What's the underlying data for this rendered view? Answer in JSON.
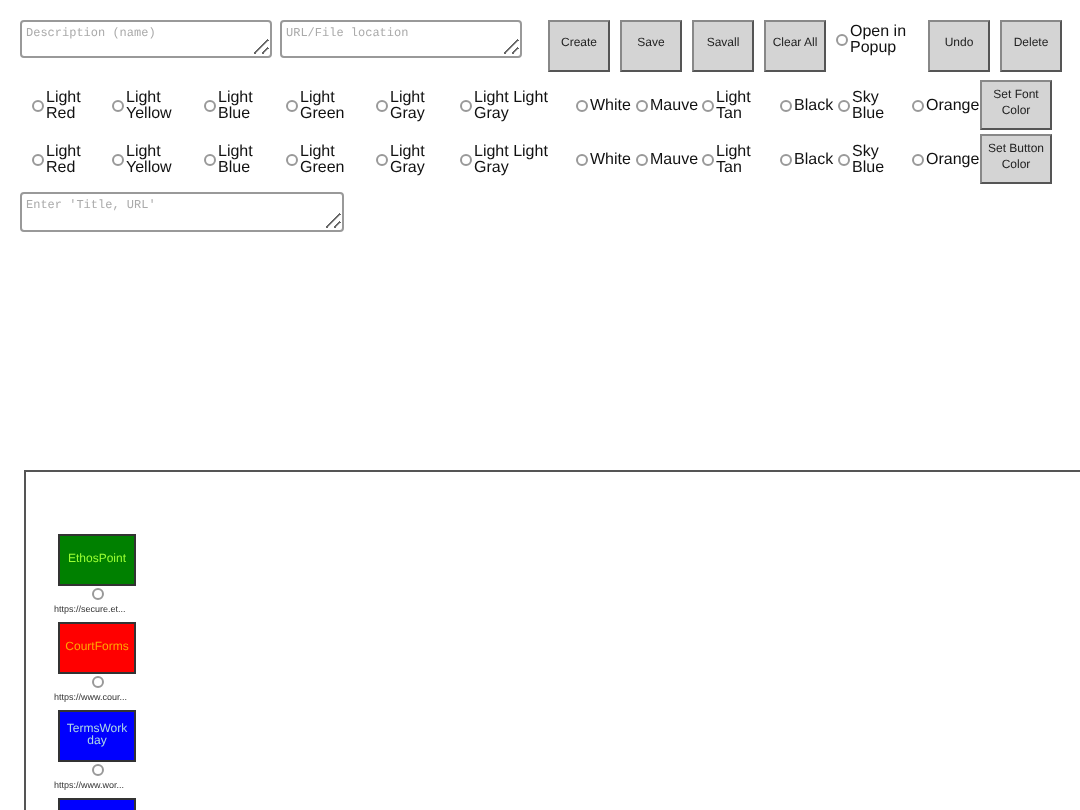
{
  "inputs": [
    {
      "placeholder": "Description (name)"
    },
    {
      "placeholder": "URL/File location"
    }
  ],
  "actions": [
    {
      "kind": "button",
      "label": "Create"
    },
    {
      "kind": "button",
      "label": "Save"
    },
    {
      "kind": "button",
      "label": "Savall"
    },
    {
      "kind": "button",
      "label": "Clear All"
    },
    {
      "kind": "radio",
      "label": "Open in Popup",
      "selected": false
    },
    {
      "kind": "button",
      "label": "Undo"
    },
    {
      "kind": "button",
      "label": "Delete"
    }
  ],
  "color_rows": [
    {
      "button": "Set Font Color",
      "options": [
        {
          "label": "Light Red",
          "selected": false
        },
        {
          "label": "Light Yellow",
          "selected": false
        },
        {
          "label": "Light Blue",
          "selected": false
        },
        {
          "label": "Light Green",
          "selected": false
        },
        {
          "label": "Light Gray",
          "selected": false
        },
        {
          "label": "Light Light Gray",
          "selected": false
        },
        {
          "label": "White",
          "selected": false
        },
        {
          "label": "Mauve",
          "selected": false
        },
        {
          "label": "Light Tan",
          "selected": false
        },
        {
          "label": "Black",
          "selected": false
        },
        {
          "label": "Sky Blue",
          "selected": false
        },
        {
          "label": "Orange",
          "selected": false
        }
      ]
    },
    {
      "button": "Set Button Color",
      "options": [
        {
          "label": "Light Red",
          "selected": false
        },
        {
          "label": "Light Yellow",
          "selected": false
        },
        {
          "label": "Light Blue",
          "selected": false
        },
        {
          "label": "Light Green",
          "selected": false
        },
        {
          "label": "Light Gray",
          "selected": false
        },
        {
          "label": "Light Light Gray",
          "selected": false
        },
        {
          "label": "White",
          "selected": false
        },
        {
          "label": "Mauve",
          "selected": false
        },
        {
          "label": "Light Tan",
          "selected": false
        },
        {
          "label": "Black",
          "selected": false
        },
        {
          "label": "Sky Blue",
          "selected": false
        },
        {
          "label": "Orange",
          "selected": false
        }
      ]
    }
  ],
  "bulk_input": {
    "placeholder": "Enter 'Title, URL'"
  },
  "links": [
    {
      "label": {
        "text": "EthosPoint",
        "color": "#99ff33"
      },
      "color": "#008000",
      "selected": false,
      "url": "https://secure.et..."
    },
    {
      "label": {
        "text": "CourtForms",
        "color": "#ffa500"
      },
      "color": "#ff0000",
      "selected": false,
      "url": "https://www.cour..."
    },
    {
      "label": {
        "text": "TermsWorkday",
        "color": "#add8e6"
      },
      "color": "#0000ff",
      "selected": false,
      "url": "https://www.wor..."
    },
    {
      "color": "#0000ff"
    }
  ]
}
